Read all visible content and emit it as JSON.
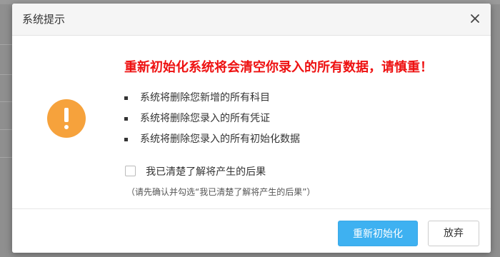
{
  "dialog": {
    "title": "系统提示",
    "headline": "重新初始化系统将会清空你录入的所有数据，请慎重！",
    "items": [
      "系统将删除您新增的所有科目",
      "系统将删除您录入的所有凭证",
      "系统将删除您录入的所有初始化数据"
    ],
    "ack_label": "我已清楚了解将产生的后果",
    "ack_checked": false,
    "ack_hint": "（请先确认并勾选“我已清楚了解将产生的后果”）",
    "primary_button": "重新初始化",
    "cancel_button": "放弃"
  },
  "icons": {
    "close": "close-icon",
    "warning": "warning-icon",
    "checkbox": "checkbox-unchecked"
  },
  "colors": {
    "headline": "#ee1111",
    "warning_icon": "#f6a23c",
    "primary_button": "#3eb1f1",
    "overlay": "#8f8f8f"
  }
}
